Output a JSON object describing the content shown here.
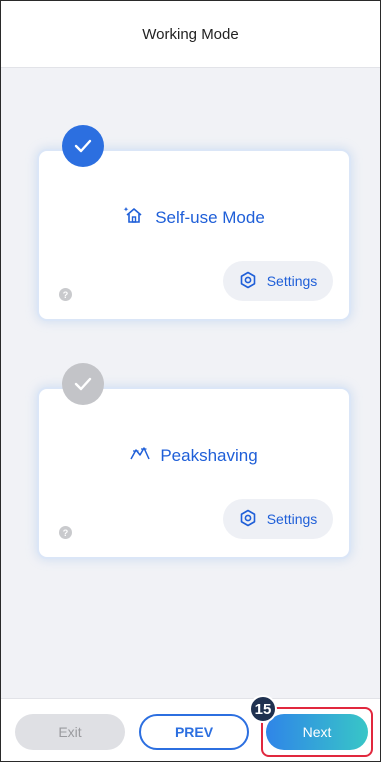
{
  "header": {
    "title": "Working Mode"
  },
  "modes": [
    {
      "label": "Self-use Mode",
      "icon": "home-sparkle-icon",
      "selected": true,
      "settings_label": "Settings",
      "help": "?"
    },
    {
      "label": "Peakshaving",
      "icon": "peak-shaving-icon",
      "selected": false,
      "settings_label": "Settings",
      "help": "?"
    }
  ],
  "footer": {
    "exit_label": "Exit",
    "prev_label": "PREV",
    "next_label": "Next",
    "step_badge": "15"
  },
  "colors": {
    "accent": "#2c6fe0",
    "highlight": "#e1283e",
    "background": "#f1f2f6"
  }
}
